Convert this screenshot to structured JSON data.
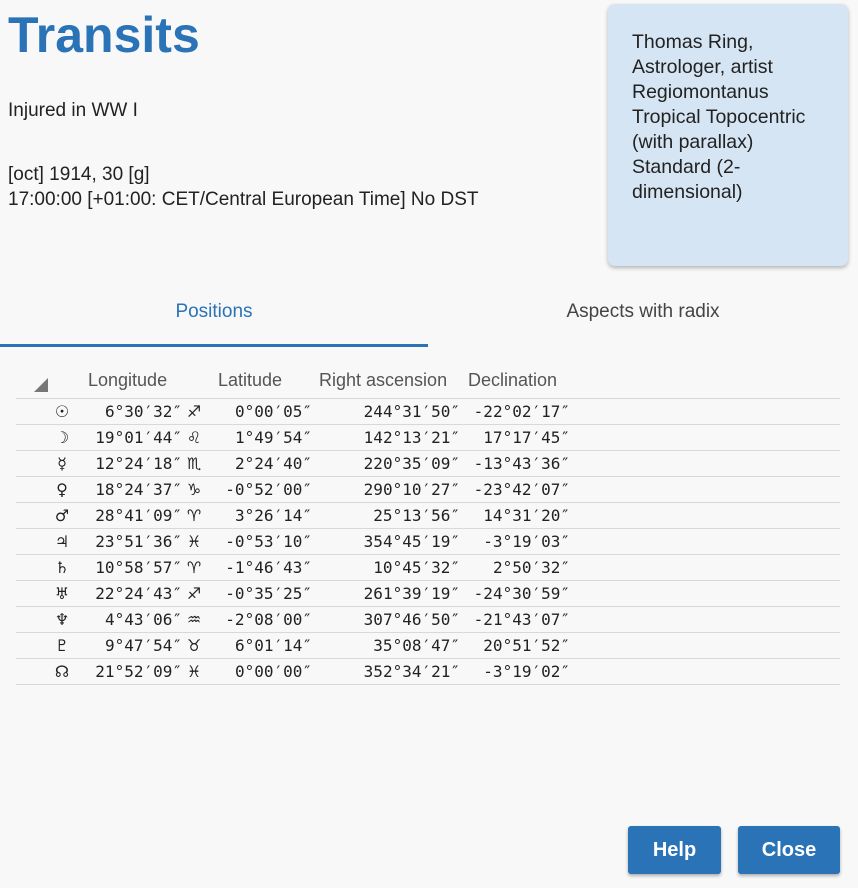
{
  "header": {
    "title": "Transits",
    "subtitle": "Injured in WW I",
    "date": "[oct] 1914, 30 [g]",
    "time": "17:00:00 [+01:00: CET/Central European Time] No DST"
  },
  "info_card": {
    "lines": [
      "Thomas Ring,",
      "Astrologer, artist",
      "Regiomontanus",
      "Tropical Topocentric",
      "(with parallax)",
      "Standard (2-",
      "dimensional)"
    ]
  },
  "tabs": [
    {
      "label": "Positions",
      "active": true
    },
    {
      "label": "Aspects with radix",
      "active": false
    }
  ],
  "table": {
    "headers": [
      "Longitude",
      "Latitude",
      "Right ascension",
      "Declination"
    ],
    "rows": [
      {
        "glyph": "☉",
        "lon": "6°30′32″",
        "sign": "♐",
        "lat": "0°00′05″",
        "ra": "244°31′50″",
        "dec": "-22°02′17″"
      },
      {
        "glyph": "☽",
        "lon": "19°01′44″",
        "sign": "♌",
        "lat": "1°49′54″",
        "ra": "142°13′21″",
        "dec": "17°17′45″"
      },
      {
        "glyph": "☿",
        "lon": "12°24′18″",
        "sign": "♏",
        "lat": "2°24′40″",
        "ra": "220°35′09″",
        "dec": "-13°43′36″"
      },
      {
        "glyph": "♀",
        "lon": "18°24′37″",
        "sign": "♑",
        "lat": "-0°52′00″",
        "ra": "290°10′27″",
        "dec": "-23°42′07″"
      },
      {
        "glyph": "♂",
        "lon": "28°41′09″",
        "sign": "♈",
        "lat": "3°26′14″",
        "ra": "25°13′56″",
        "dec": "14°31′20″"
      },
      {
        "glyph": "♃",
        "lon": "23°51′36″",
        "sign": "♓",
        "lat": "-0°53′10″",
        "ra": "354°45′19″",
        "dec": "-3°19′03″"
      },
      {
        "glyph": "♄",
        "lon": "10°58′57″",
        "sign": "♈",
        "lat": "-1°46′43″",
        "ra": "10°45′32″",
        "dec": "2°50′32″"
      },
      {
        "glyph": "♅",
        "lon": "22°24′43″",
        "sign": "♐",
        "lat": "-0°35′25″",
        "ra": "261°39′19″",
        "dec": "-24°30′59″"
      },
      {
        "glyph": "♆",
        "lon": "4°43′06″",
        "sign": "♒",
        "lat": "-2°08′00″",
        "ra": "307°46′50″",
        "dec": "-21°43′07″"
      },
      {
        "glyph": "♇",
        "lon": "9°47′54″",
        "sign": "♉",
        "lat": "6°01′14″",
        "ra": "35°08′47″",
        "dec": "20°51′52″"
      },
      {
        "glyph": "☊",
        "lon": "21°52′09″",
        "sign": "♓",
        "lat": "0°00′00″",
        "ra": "352°34′21″",
        "dec": "-3°19′02″"
      }
    ]
  },
  "buttons": {
    "help": "Help",
    "close": "Close"
  }
}
